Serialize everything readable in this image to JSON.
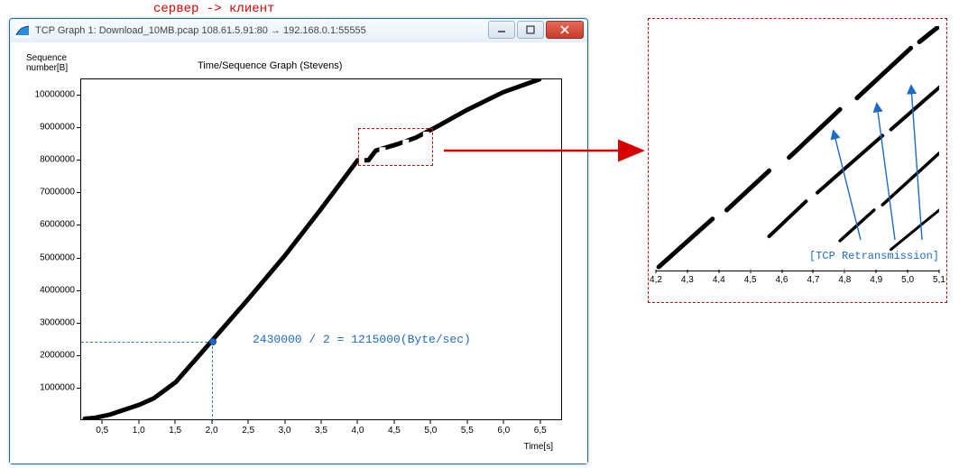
{
  "top_annotation": "сервер -> клиент",
  "window": {
    "title": "TCP Graph 1: Download_10MB.pcap 108.61.5.91:80 → 192.168.0.1:55555",
    "minimize_tip": "Minimize",
    "maximize_tip": "Maximize",
    "close_tip": "Close"
  },
  "chart": {
    "title": "Time/Sequence Graph (Stevens)",
    "y_title_line1": "Sequence",
    "y_title_line2": "number[B]",
    "x_title": "Time[s]",
    "y_ticks": [
      "1000000",
      "2000000",
      "3000000",
      "4000000",
      "5000000",
      "6000000",
      "7000000",
      "8000000",
      "9000000",
      "10000000"
    ],
    "x_ticks": [
      "0,5",
      "1,0",
      "1,5",
      "2,0",
      "2,5",
      "3,0",
      "3,5",
      "4,0",
      "4,5",
      "5,0",
      "5,5",
      "6,0",
      "6,5"
    ]
  },
  "annotations": {
    "speed_calc": "2430000 / 2 = 1215000(Byte/sec)",
    "retransmission_label": "[TCP Retransmission]"
  },
  "zoom": {
    "x_ticks": [
      "4,2",
      "4,3",
      "4,4",
      "4,5",
      "4,6",
      "4,7",
      "4,8",
      "4,9",
      "5,0",
      "5,1"
    ]
  },
  "chart_data": {
    "type": "line",
    "title": "Time/Sequence Graph (Stevens)",
    "xlabel": "Time[s]",
    "ylabel": "Sequence number[B]",
    "xlim": [
      0.2,
      6.8
    ],
    "ylim": [
      0,
      10500000
    ],
    "series": [
      {
        "name": "sequence",
        "x": [
          0.25,
          0.4,
          0.6,
          0.8,
          1.0,
          1.2,
          1.5,
          2.0,
          2.5,
          3.0,
          3.5,
          4.0,
          4.15,
          4.25,
          4.55,
          4.8,
          5.1,
          5.5,
          6.0,
          6.5
        ],
        "y": [
          20000,
          50000,
          150000,
          300000,
          450000,
          650000,
          1150000,
          2430000,
          3720000,
          5050000,
          6500000,
          8000000,
          8000000,
          8300000,
          8500000,
          8700000,
          9050000,
          9550000,
          10100000,
          10500000
        ]
      }
    ],
    "annotations": [
      {
        "type": "marker",
        "x": 2.0,
        "y": 2430000
      },
      {
        "type": "text",
        "x": 2.5,
        "y": 2430000,
        "text": "2430000 / 2 = 1215000(Byte/sec)"
      }
    ],
    "zoom_region": {
      "x_range": [
        4.0,
        5.0
      ],
      "y_range": [
        7900000,
        9000000
      ]
    },
    "retransmissions_approx": [
      {
        "t": 4.6,
        "seq_from": 8400000,
        "seq_to": 8600000
      },
      {
        "t": 4.85,
        "seq_from": 8300000,
        "seq_to": 9000000
      },
      {
        "t": 5.05,
        "seq_from": 8250000,
        "seq_to": 9100000
      }
    ]
  }
}
